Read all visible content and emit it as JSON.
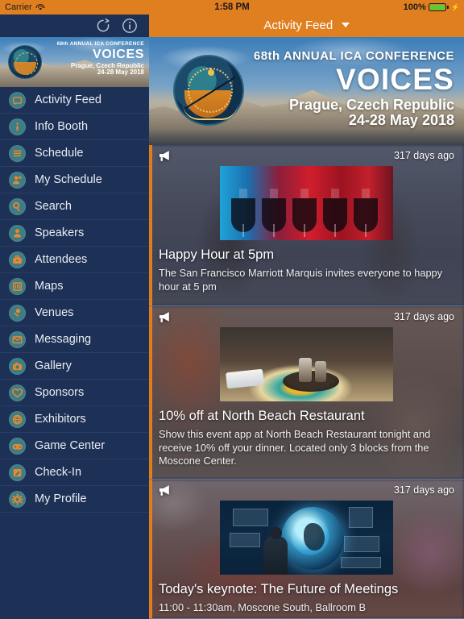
{
  "status_bar": {
    "carrier": "Carrier",
    "wifi_icon": "wifi-icon",
    "time": "1:58 PM",
    "battery_percent": "100%",
    "battery_icon": "battery-full-icon",
    "charging_icon": "bolt-icon"
  },
  "left_nav": {
    "refresh_icon": "refresh-icon",
    "info_icon": "info-circle-icon"
  },
  "right_nav": {
    "title": "Activity Feed",
    "dropdown_icon": "chevron-down-icon"
  },
  "sidebar_banner": {
    "line1": "68th ANNUAL ICA CONFERENCE",
    "line2": "VOICES",
    "line3": "Prague, Czech Republic",
    "line4": "24-28 May 2018",
    "logo_icon": "ica-prague-logo-icon"
  },
  "hero_banner": {
    "line1": "68th ANNUAL ICA CONFERENCE",
    "line2": "VOICES",
    "line3": "Prague, Czech Republic",
    "line4": "24-28 May 2018",
    "logo_icon": "ica-prague-logo-icon"
  },
  "sidebar": {
    "items": [
      {
        "label": "Activity Feed",
        "icon": "speech-bubble-icon"
      },
      {
        "label": "Info Booth",
        "icon": "info-icon"
      },
      {
        "label": "Schedule",
        "icon": "list-lines-icon"
      },
      {
        "label": "My Schedule",
        "icon": "person-plus-icon"
      },
      {
        "label": "Search",
        "icon": "magnifier-icon"
      },
      {
        "label": "Speakers",
        "icon": "person-icon"
      },
      {
        "label": "Attendees",
        "icon": "briefcase-icon"
      },
      {
        "label": "Maps",
        "icon": "map-book-icon"
      },
      {
        "label": "Venues",
        "icon": "pin-icon"
      },
      {
        "label": "Messaging",
        "icon": "envelope-icon"
      },
      {
        "label": "Gallery",
        "icon": "camera-icon"
      },
      {
        "label": "Sponsors",
        "icon": "heart-icon"
      },
      {
        "label": "Exhibitors",
        "icon": "globe-grid-icon"
      },
      {
        "label": "Game Center",
        "icon": "gamepad-icon"
      },
      {
        "label": "Check-In",
        "icon": "clipboard-pencil-icon"
      },
      {
        "label": "My Profile",
        "icon": "gear-icon"
      }
    ]
  },
  "feed": {
    "cards": [
      {
        "announcement_icon": "megaphone-icon",
        "time": "317 days ago",
        "thumbnail": "wine-glasses-photo",
        "title": "Happy Hour at 5pm",
        "body": "The San Francisco Marriott Marquis invites everyone to happy hour at 5 pm"
      },
      {
        "announcement_icon": "megaphone-icon",
        "time": "317 days ago",
        "thumbnail": "restaurant-table-photo",
        "title": "10% off at North Beach Restaurant",
        "body": "Show this event app at North Beach Restaurant tonight and receive 10% off your dinner. Located only 3 blocks from the Moscone Center."
      },
      {
        "announcement_icon": "megaphone-icon",
        "time": "317 days ago",
        "thumbnail": "global-technology-photo",
        "title": "Today's keynote: The Future of Meetings",
        "body": "11:00 - 11:30am, Moscone South, Ballroom B"
      }
    ]
  },
  "colors": {
    "accent_orange": "#e07f20",
    "sidebar_navy": "#1d3055",
    "icon_teal": "#3f7d86",
    "icon_glyph_orange": "#e8892a",
    "battery_green": "#4cd336"
  }
}
